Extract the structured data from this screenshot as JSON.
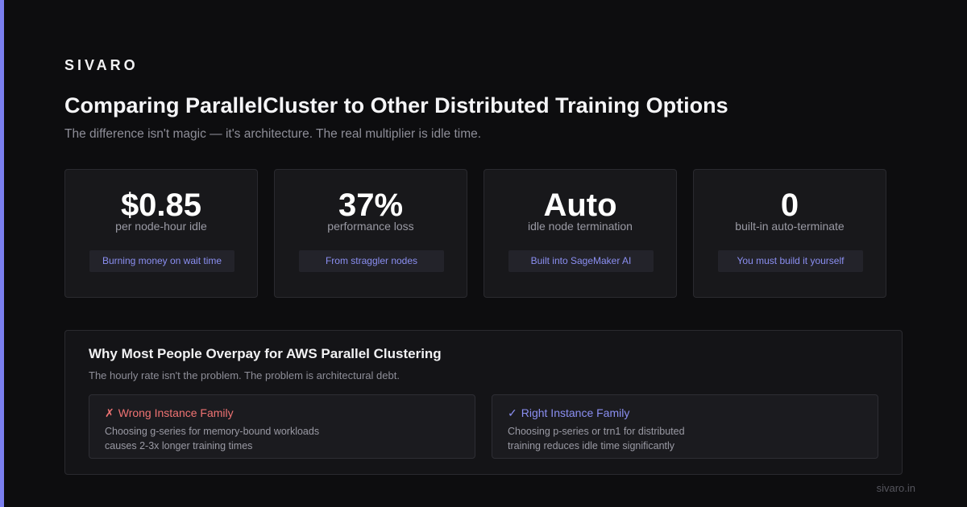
{
  "brand": "SIVARO",
  "title": "Comparing ParallelCluster to Other Distributed Training Options",
  "subtitle": "The difference isn't magic — it's architecture. The real multiplier is idle time.",
  "stats": [
    {
      "value": "$0.85",
      "label": "per node-hour idle",
      "tag": "Burning money on wait time"
    },
    {
      "value": "37%",
      "label": "performance loss",
      "tag": "From straggler nodes"
    },
    {
      "value": "Auto",
      "label": "idle node termination",
      "tag": "Built into SageMaker AI"
    },
    {
      "value": "0",
      "label": "built-in auto-terminate",
      "tag": "You must build it yourself"
    }
  ],
  "panel": {
    "title": "Why Most People Overpay for AWS Parallel Clustering",
    "subtitle": "The hourly rate isn't the problem. The problem is architectural debt.",
    "wrong": {
      "mark": "✗",
      "heading": "Wrong Instance Family",
      "desc_line1": "Choosing g-series for memory-bound workloads",
      "desc_line2": "causes 2-3x longer training times"
    },
    "right": {
      "mark": "✓",
      "heading": "Right Instance Family",
      "desc_line1": "Choosing p-series or trn1 for distributed",
      "desc_line2": "training reduces idle time significantly"
    }
  },
  "footer": "sivaro.in",
  "colors": {
    "accent": "#7b7ff0",
    "tag_text": "#8b8ff2",
    "wrong": "#f07373",
    "background": "#0d0d0f"
  }
}
